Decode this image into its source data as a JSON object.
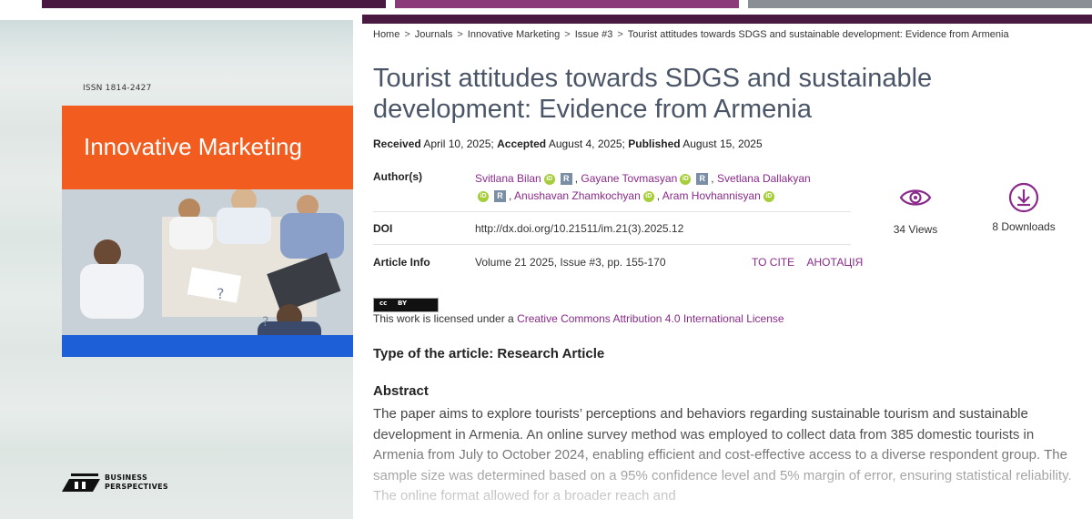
{
  "cover": {
    "issn": "ISSN 1814-2427",
    "journal_title": "Innovative Marketing",
    "publisher_line1": "BUSINESS",
    "publisher_line2": "PERSPECTIVES"
  },
  "breadcrumb": [
    "Home",
    "Journals",
    "Innovative Marketing",
    "Issue #3",
    "Tourist attitudes towards SDGS and sustainable development: Evidence from Armenia"
  ],
  "breadcrumb_separator": ">",
  "article": {
    "title": "Tourist attitudes towards SDGS and sustainable development: Evidence from Armenia",
    "received_label": "Received",
    "received": "April 10, 2025;",
    "accepted_label": "Accepted",
    "accepted": "August 4, 2025;",
    "published_label": "Published",
    "published": "August 15, 2025",
    "authors_label": "Author(s)",
    "authors": [
      "Svitlana Bilan",
      "Gayane Tovmasyan",
      "Svetlana Dallakyan",
      "Anushavan Zhamkochyan",
      "Aram Hovhannisyan"
    ],
    "author_separator": ",",
    "orcid_glyph": "iD",
    "researchgate_glyph": "R",
    "doi_label": "DOI",
    "doi": "http://dx.doi.org/10.21511/im.21(3).2025.12",
    "info_label": "Article Info",
    "info": "Volume 21 2025, Issue #3, pp. 155-170",
    "to_cite": "TO CITE",
    "anotation": "АНОТАЦІЯ"
  },
  "stats": {
    "views": "34 Views",
    "downloads": "8 Downloads",
    "views_icon": "eye-icon",
    "downloads_icon": "download-icon"
  },
  "license": {
    "badge_cc": "cc",
    "badge_by": "BY",
    "prefix": "This work is licensed under a ",
    "link": "Creative Commons Attribution 4.0 International License"
  },
  "type_of_article": "Type of the article: Research Article",
  "abstract": {
    "heading": "Abstract",
    "text": "The paper aims to explore tourists’ perceptions and behaviors regarding sustainable tourism and sustainable development in Armenia. An online survey method was employed to collect data from 385 domestic tourists in Armenia from July to October 2024, enabling efficient and cost-effective access to a diverse respondent group. The sample size was determined based on a 95% confidence level and 5% margin of error, ensuring statistical reliability. The online format allowed for a broader reach and"
  },
  "colors": {
    "brand_dark": "#4a1942",
    "brand_mid": "#8b3a7a",
    "link": "#8a2a8a",
    "cover_orange": "#f25d1f",
    "cover_blue": "#1c5fd6",
    "orcid": "#a6ce39"
  }
}
